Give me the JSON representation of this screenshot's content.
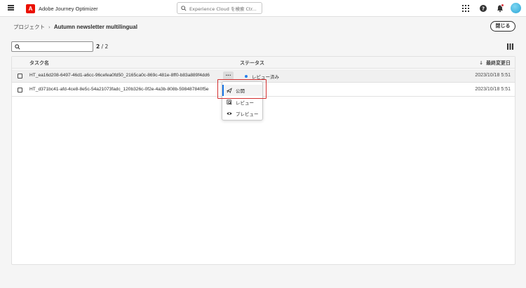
{
  "app": {
    "brand_name": "Adobe Journey Optimizer",
    "logo_letter": "A",
    "search_placeholder": "Experience Cloud を検索 Ctr..."
  },
  "header": {
    "breadcrumb_parent": "プロジェクト",
    "breadcrumb_separator": "›",
    "breadcrumb_current": "Autumn newsletter multilingual",
    "close_label": "閉じる"
  },
  "filter": {
    "placeholder": "",
    "count_shown": "2",
    "count_sep": " / ",
    "count_total": "2"
  },
  "table": {
    "columns": {
      "name": "タスク名",
      "status": "ステータス",
      "date_arrow": "↓",
      "date": "最終変更日"
    },
    "rows": [
      {
        "name": "HT_ea16d208-6497-46d1-a6cc-96cefea0fd50_2165ca0c-869c-481e-8ff0-b83a889f4dd6",
        "more_label": "...",
        "status": "レビュー済み",
        "date": "2023/10/18 5:51"
      },
      {
        "name": "HT_d371bc41-afd-4ce8-8e5c-54a21073fadc_120b326c-0f2e-4a3b-808b-598487840f5e",
        "more_label": "",
        "status": "",
        "date": "2023/10/18 5:51"
      }
    ]
  },
  "menu": {
    "items": [
      {
        "label": "公開",
        "icon": "publish-icon"
      },
      {
        "label": "レビュー",
        "icon": "review-icon"
      },
      {
        "label": "プレビュー",
        "icon": "preview-icon"
      }
    ]
  },
  "colors": {
    "accent": "#1473e6",
    "status_dot": "#2680eb",
    "highlight": "#d32f2f",
    "brand": "#eb1000"
  }
}
